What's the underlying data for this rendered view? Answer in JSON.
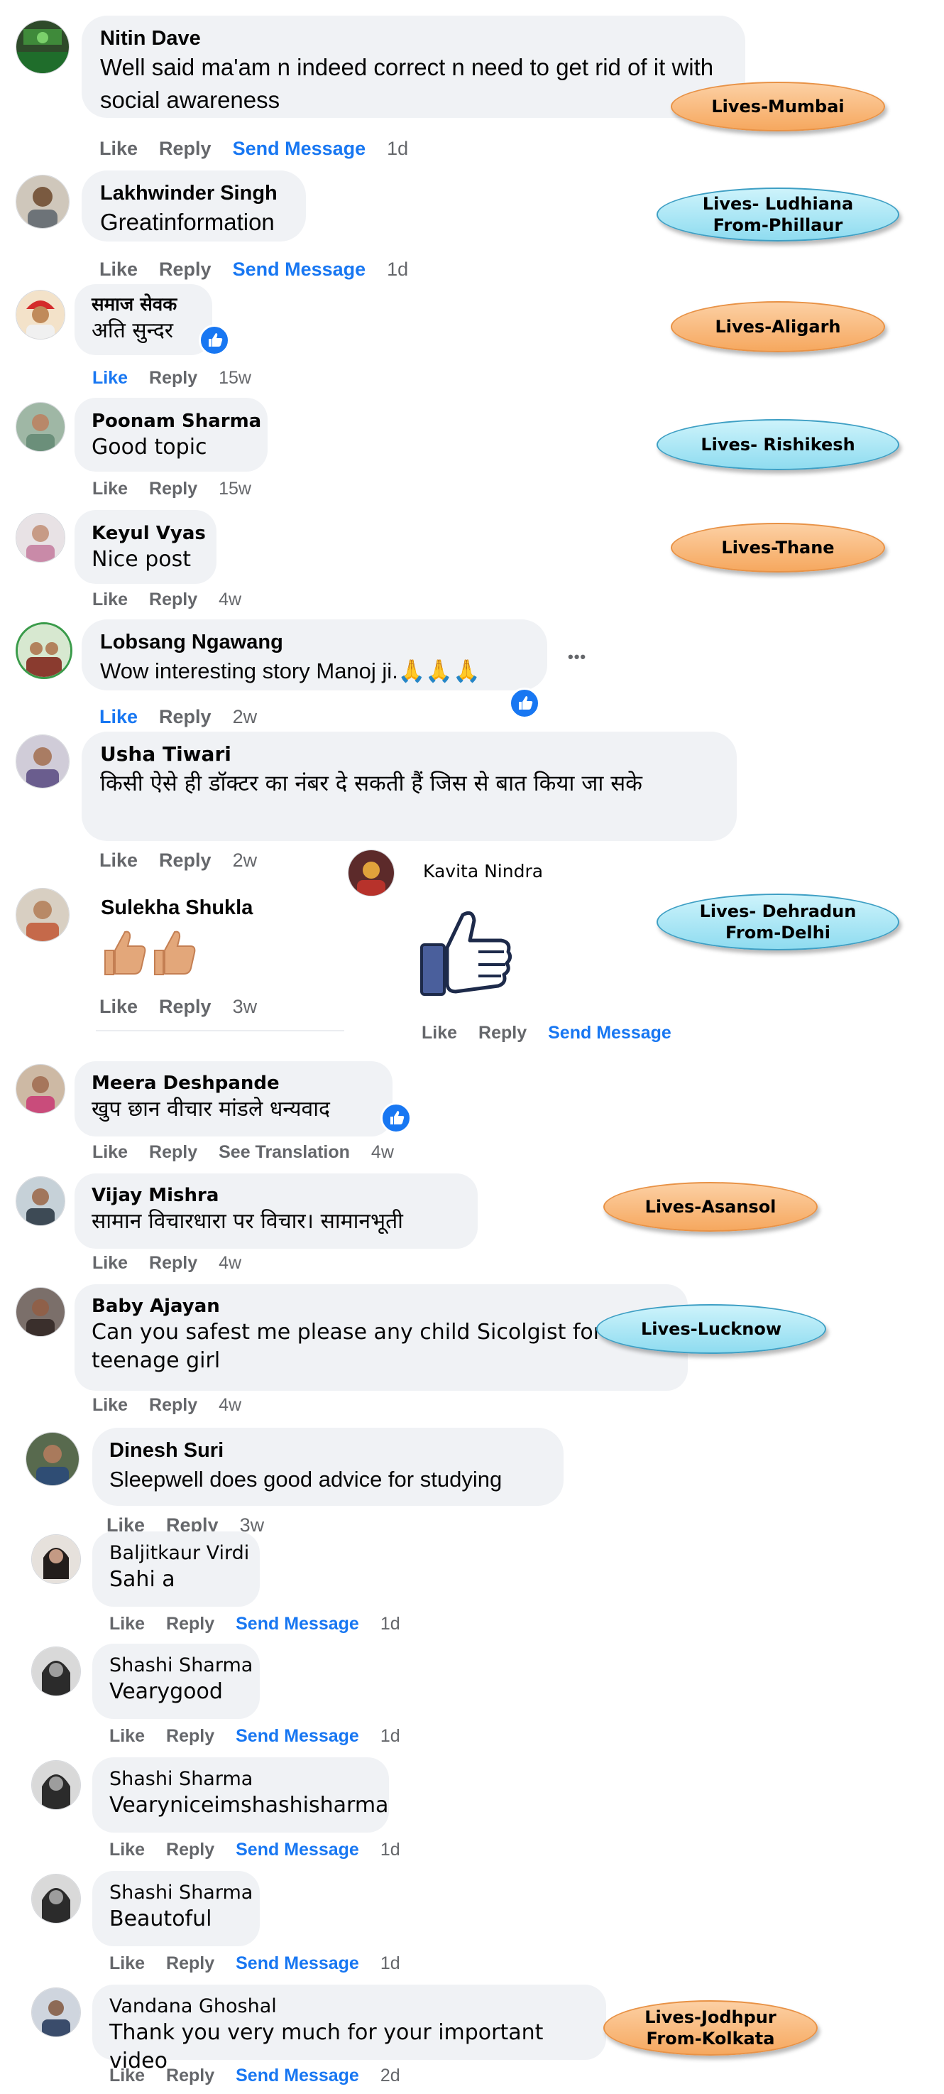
{
  "comments": [
    {
      "name": "Nitin Dave",
      "text": "Well said ma'am n indeed correct n need to get rid of it with social awareness",
      "like": "Like",
      "reply": "Reply",
      "send": "Send Message",
      "time": "1d"
    },
    {
      "name": "Lakhwinder Singh",
      "text": "Greatinformation",
      "like": "Like",
      "reply": "Reply",
      "send": "Send Message",
      "time": "1d"
    },
    {
      "name": "समाज सेवक",
      "text": "अति सुन्दर",
      "like": "Like",
      "reply": "Reply",
      "time": "15w"
    },
    {
      "name": "Poonam Sharma",
      "text": "Good topic",
      "like": "Like",
      "reply": "Reply",
      "time": "15w"
    },
    {
      "name": "Keyul Vyas",
      "text": "Nice post",
      "like": "Like",
      "reply": "Reply",
      "time": "4w"
    },
    {
      "name": "Lobsang Ngawang",
      "text": "Wow interesting story Manoj ji.🙏🙏🙏",
      "like": "Like",
      "reply": "Reply",
      "time": "2w",
      "more": "•••"
    },
    {
      "name": "Usha Tiwari",
      "text": "किसी ऐसे ही डॉक्टर का नंबर दे सकती हैं जिस से बात किया जा सके",
      "like": "Like",
      "reply": "Reply",
      "time": "2w"
    },
    {
      "name": "Sulekha Shukla",
      "text": "",
      "like": "Like",
      "reply": "Reply",
      "time": "3w"
    },
    {
      "name": "Meera Deshpande",
      "text": "खुप छान वीचार मांडले धन्यवाद",
      "like": "Like",
      "reply": "Reply",
      "translate": "See Translation",
      "time": "4w"
    },
    {
      "name": "Vijay Mishra",
      "text": "सामान विचारधारा पर विचार। सामानभूती",
      "like": "Like",
      "reply": "Reply",
      "time": "4w"
    },
    {
      "name": "Baby Ajayan",
      "text": "Can you safest me please any child Sicolgist for teenage girl",
      "like": "Like",
      "reply": "Reply",
      "time": "4w"
    },
    {
      "name": "Dinesh Suri",
      "text": "Sleepwell does good advice for studying",
      "like": "Like",
      "reply": "Reply",
      "time": "3w"
    },
    {
      "name": "Baljitkaur Virdi",
      "text": "Sahi a",
      "like": "Like",
      "reply": "Reply",
      "send": "Send Message",
      "time": "1d"
    },
    {
      "name": "Shashi Sharma",
      "text": "Vearygood",
      "like": "Like",
      "reply": "Reply",
      "send": "Send Message",
      "time": "1d"
    },
    {
      "name": "Shashi Sharma",
      "text": "Vearyniceimshashisharma",
      "like": "Like",
      "reply": "Reply",
      "send": "Send Message",
      "time": "1d"
    },
    {
      "name": "Shashi Sharma",
      "text": "Beautoful",
      "like": "Like",
      "reply": "Reply",
      "send": "Send Message",
      "time": "1d"
    },
    {
      "name": "Vandana Ghoshal",
      "text": "Thank you very much for your important video",
      "like": "Like",
      "reply": "Reply",
      "send": "Send Message",
      "time": "2d"
    }
  ],
  "kavita": {
    "name": "Kavita Nindra",
    "like": "Like",
    "reply": "Reply",
    "send": "Send Message"
  },
  "tags": [
    {
      "label": "Lives-Mumbai",
      "color": "orange"
    },
    {
      "label": "Lives- Ludhiana\nFrom-Phillaur",
      "color": "blue"
    },
    {
      "label": "Lives-Aligarh",
      "color": "orange"
    },
    {
      "label": "Lives- Rishikesh",
      "color": "blue"
    },
    {
      "label": "Lives-Thane",
      "color": "orange"
    },
    {
      "label": "Lives- Dehradun\nFrom-Delhi",
      "color": "blue"
    },
    {
      "label": "Lives-Asansol",
      "color": "orange"
    },
    {
      "label": "Lives-Lucknow",
      "color": "blue"
    },
    {
      "label": "Lives-Jodhpur\nFrom-Kolkata",
      "color": "orange"
    }
  ],
  "colors": {
    "orange": "#f6a85f",
    "blue": "#8fdcf0",
    "link": "#1877f2",
    "bubble": "#f0f2f5",
    "meta": "#65676b"
  },
  "icons": {
    "reaction": "thumbs-up-icon",
    "sticker": "thumbs-up-sticker",
    "emoji": "thumbs-up-emoji"
  }
}
